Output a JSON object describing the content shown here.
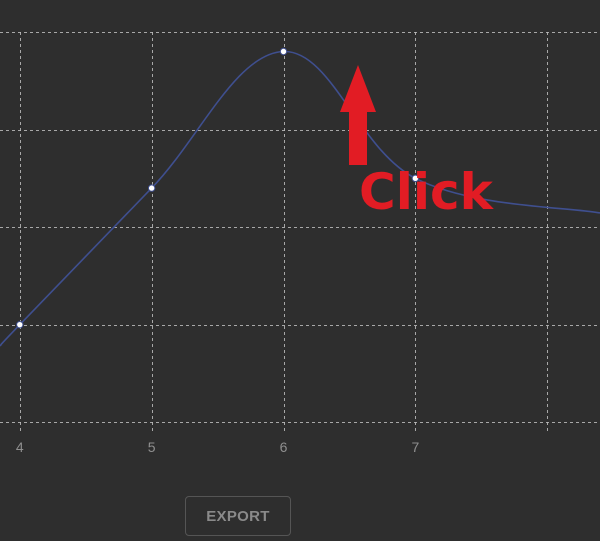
{
  "chart_data": {
    "type": "line",
    "x": [
      4,
      5,
      6,
      7
    ],
    "series": [
      {
        "values": [
          12,
          26,
          40,
          27
        ]
      }
    ],
    "xlim": [
      3.85,
      8.4
    ],
    "ylim": [
      1,
      42
    ],
    "ytick_values": [
      2,
      12,
      22,
      32,
      42
    ],
    "xticks": [
      4,
      5,
      6,
      7
    ],
    "xtick_labels": [
      "4",
      "5",
      "6",
      "7"
    ],
    "grid": true,
    "line_color": "#3f4f8f",
    "grid_color": "#bdbdbd"
  },
  "annotation": {
    "label": "Click",
    "target_x": 6,
    "color": "#e21c24"
  },
  "toolbar": {
    "export_label": "EXPORT"
  },
  "colors": {
    "background": "#2e2e2e",
    "point_fill": "#ffffff",
    "tick_label": "#8f8f8f",
    "button_text": "#8a8a8a",
    "button_border": "#555555"
  }
}
